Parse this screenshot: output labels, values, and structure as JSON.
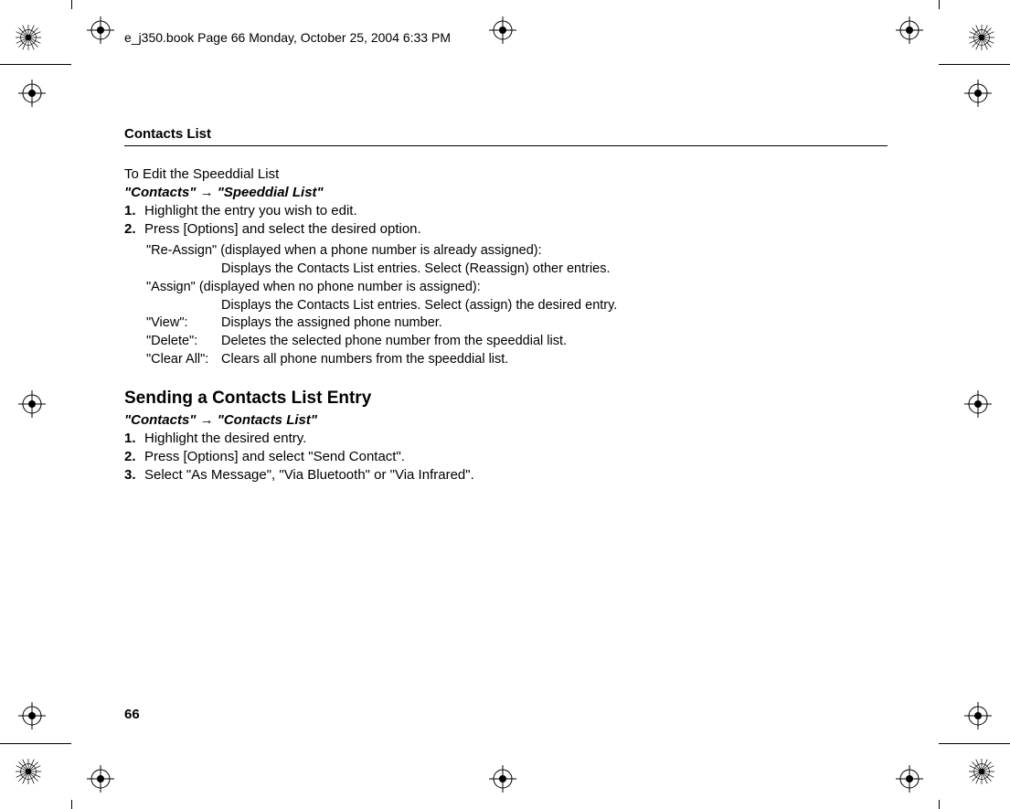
{
  "header": "e_j350.book  Page 66  Monday, October 25, 2004  6:33 PM",
  "section": "Contacts List",
  "sub1": {
    "title": "To Edit the Speeddial List",
    "nav": "\"Contacts\" → \"Speeddial List\"",
    "steps": [
      {
        "n": "1.",
        "t": "Highlight the entry you wish to edit."
      },
      {
        "n": "2.",
        "t": "Press [Options] and select the desired option."
      }
    ],
    "opts": [
      {
        "l": "\"Re-Assign\" (displayed when a phone number is already assigned):",
        "full": true
      },
      {
        "l": "",
        "d": "Displays the Contacts List entries. Select (Reassign) other entries."
      },
      {
        "l": "\"Assign\" (displayed when no phone number is assigned):",
        "full": true
      },
      {
        "l": "",
        "d": "Displays the Contacts List entries. Select (assign) the desired entry."
      },
      {
        "l": "\"View\":",
        "d": "Displays the assigned phone number."
      },
      {
        "l": "\"Delete\":",
        "d": "Deletes the selected phone number from the speeddial list."
      },
      {
        "l": "\"Clear All\":",
        "d": "Clears all phone numbers from the speeddial list."
      }
    ]
  },
  "sub2": {
    "title": "Sending a Contacts List Entry",
    "nav": "\"Contacts\" → \"Contacts List\"",
    "steps": [
      {
        "n": "1.",
        "t": "Highlight the desired entry."
      },
      {
        "n": "2.",
        "t": "Press [Options] and select \"Send Contact\"."
      },
      {
        "n": "3.",
        "t": "Select \"As Message\", \"Via Bluetooth\" or \"Via Infrared\"."
      }
    ]
  },
  "pageNum": "66"
}
